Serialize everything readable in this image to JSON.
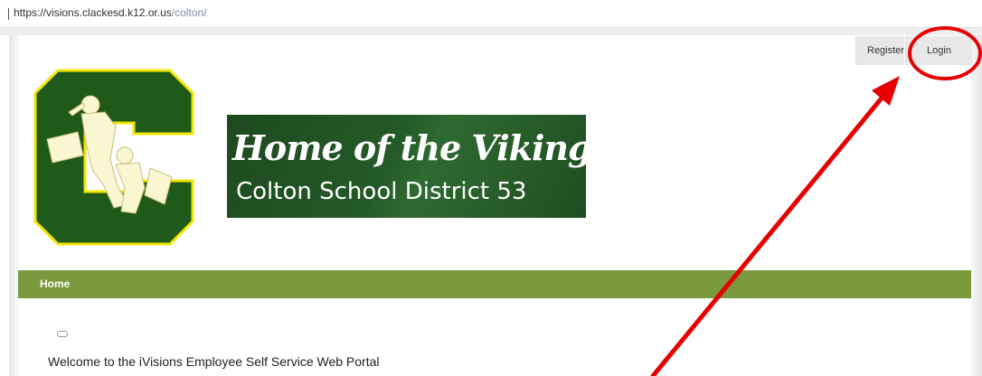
{
  "browser": {
    "url_scheme": "https://",
    "url_host": "visions.clackesd.k12.or.us",
    "url_path": "/colton/"
  },
  "topnav": {
    "register_label": "Register",
    "login_label": "Login"
  },
  "banner": {
    "script_text": "Home of the Vikings",
    "district_text": "Colton School District 53"
  },
  "menu": {
    "items": [
      {
        "label": "Home"
      }
    ]
  },
  "content": {
    "welcome_text": "Welcome to the iVisions Employee Self Service Web Portal"
  },
  "colors": {
    "school_green": "#1f5a1a",
    "school_gold": "#f2e600",
    "menu_green": "#7a9a3d",
    "annotation_red": "#e60000"
  },
  "icons": [
    "c-logo-icon",
    "collapse-toggle-icon"
  ]
}
